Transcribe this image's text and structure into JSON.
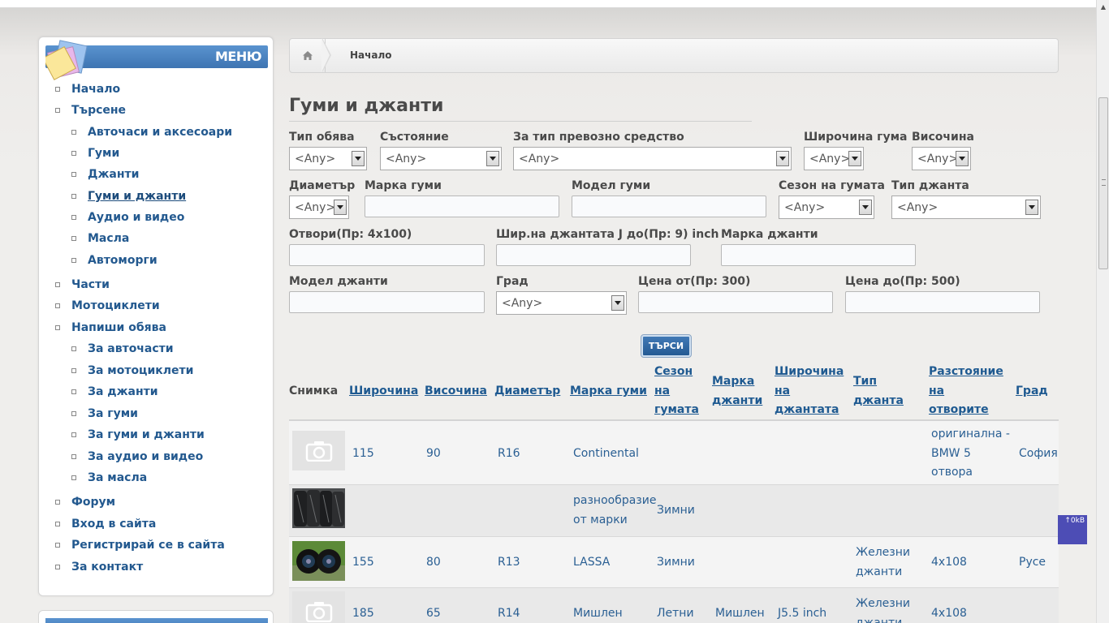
{
  "menu": {
    "title": "МЕНЮ",
    "items": [
      {
        "label": "Начало",
        "level": 0
      },
      {
        "label": "Търсене",
        "level": 0
      },
      {
        "label": "Авточаси и аксесоари",
        "level": 1
      },
      {
        "label": "Гуми",
        "level": 1
      },
      {
        "label": "Джанти",
        "level": 1
      },
      {
        "label": "Гуми и джанти",
        "level": 1,
        "active": true
      },
      {
        "label": "Аудио и видео",
        "level": 1
      },
      {
        "label": "Масла",
        "level": 1
      },
      {
        "label": "Автоморги",
        "level": 1
      },
      {
        "label": "Части",
        "level": 0
      },
      {
        "label": "Мотоциклети",
        "level": 0
      },
      {
        "label": "Напиши обява",
        "level": 0
      },
      {
        "label": "За авточасти",
        "level": 1
      },
      {
        "label": "За мотоциклети",
        "level": 1
      },
      {
        "label": "За джанти",
        "level": 1
      },
      {
        "label": "За гуми",
        "level": 1
      },
      {
        "label": "За гуми и джанти",
        "level": 1
      },
      {
        "label": "За аудио и видео",
        "level": 1
      },
      {
        "label": "За масла",
        "level": 1
      },
      {
        "label": "Форум",
        "level": 0
      },
      {
        "label": "Вход в сайта",
        "level": 0
      },
      {
        "label": "Регистрирай се в сайта",
        "level": 0
      },
      {
        "label": "За контакт",
        "level": 0
      }
    ]
  },
  "breadcrumb": {
    "current": "Начало"
  },
  "page": {
    "title": "Гуми и джанти"
  },
  "filters": {
    "listing_type": {
      "label": "Тип обява",
      "value": "<Any>"
    },
    "condition": {
      "label": "Състояние",
      "value": "<Any>"
    },
    "vehicle_type": {
      "label": "За тип превозно средство",
      "value": "<Any>"
    },
    "tire_width": {
      "label": "Широчина гума",
      "value": "<Any>"
    },
    "height": {
      "label": "Височина",
      "value": "<Any>"
    },
    "diameter": {
      "label": "Диаметър",
      "value": "<Any>"
    },
    "tire_brand": {
      "label": "Марка гуми",
      "value": ""
    },
    "tire_model": {
      "label": "Модел гуми",
      "value": ""
    },
    "tire_season": {
      "label": "Сезон на гумата",
      "value": "<Any>"
    },
    "rim_type": {
      "label": "Тип джанта",
      "value": "<Any>"
    },
    "bolt_pattern": {
      "label": "Отвори(Пр: 4x100)",
      "value": ""
    },
    "rim_width": {
      "label": "Шир.на джантата J до(Пр: 9) inch",
      "value": ""
    },
    "rim_brand": {
      "label": "Марка джанти",
      "value": ""
    },
    "rim_model": {
      "label": "Модел джанти",
      "value": ""
    },
    "city": {
      "label": "Град",
      "value": "<Any>"
    },
    "price_from": {
      "label": "Цена от(Пр: 300)",
      "value": ""
    },
    "price_to": {
      "label": "Цена до(Пр: 500)",
      "value": ""
    },
    "search_label": "ТЪРСИ"
  },
  "table": {
    "headers": {
      "photo": "Снимка",
      "width": "Широчина",
      "height": "Височина",
      "diameter": "Диаметър",
      "tire_brand": "Марка гуми",
      "season": [
        "Сезон",
        "на",
        "гумата"
      ],
      "rim_brand": [
        "Марка",
        "джанти"
      ],
      "rim_width": [
        "Широчина",
        "на",
        "джантата"
      ],
      "rim_type": [
        "Тип",
        "джанта"
      ],
      "bolt": [
        "Разстояние",
        "на",
        "отворите"
      ],
      "city": "Град"
    },
    "rows": [
      {
        "photo": "placeholder",
        "width": "115",
        "height": "90",
        "diameter": "R16",
        "tire_brand": "Continental",
        "season": "",
        "rim_brand": "",
        "rim_width": "",
        "rim_type": "",
        "bolt": [
          "оригинална -",
          "BMW 5",
          "отвора"
        ],
        "city": "София"
      },
      {
        "photo": "tires",
        "width": "",
        "height": "",
        "diameter": "",
        "tire_brand": [
          "разнообразие",
          "от марки"
        ],
        "season": "Зимни",
        "rim_brand": "",
        "rim_width": "",
        "rim_type": "",
        "bolt": "",
        "city": ""
      },
      {
        "photo": "wheels",
        "width": "155",
        "height": "80",
        "diameter": "R13",
        "tire_brand": "LASSA",
        "season": "Зимни",
        "rim_brand": "",
        "rim_width": "",
        "rim_type": [
          "Железни",
          "джанти"
        ],
        "bolt": "4x108",
        "city": "Русе"
      },
      {
        "photo": "placeholder",
        "width": "185",
        "height": "65",
        "diameter": "R14",
        "tire_brand": "Мишлен",
        "season": "Летни",
        "rim_brand": "Мишлен",
        "rim_width": "J5.5 inch",
        "rim_type": [
          "Железни",
          "джанти"
        ],
        "bolt": "4x108",
        "city": ""
      }
    ]
  },
  "widget": {
    "label": "↑0kB"
  }
}
